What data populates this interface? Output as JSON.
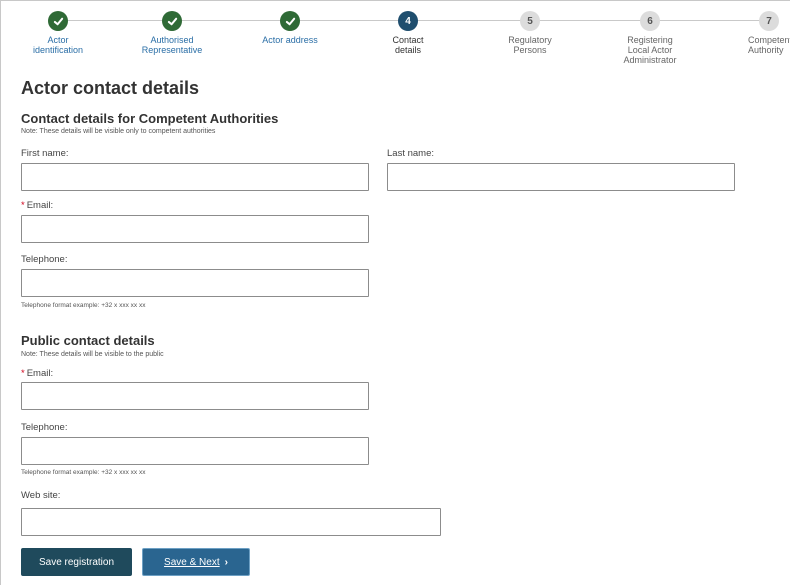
{
  "stepper": {
    "steps": [
      {
        "number": "",
        "label": "Actor\nidentification",
        "state": "done"
      },
      {
        "number": "",
        "label": "Authorised\nRepresentative",
        "state": "done"
      },
      {
        "number": "",
        "label": "Actor address",
        "state": "done"
      },
      {
        "number": "4",
        "label": "Contact\ndetails",
        "state": "current"
      },
      {
        "number": "5",
        "label": "Regulatory\nPersons",
        "state": "todo"
      },
      {
        "number": "6",
        "label": "Registering\nLocal Actor\nAdministrator",
        "state": "todo"
      },
      {
        "number": "7",
        "label": "Competent\nAuthority",
        "state": "todo"
      }
    ],
    "done_icon": "check-icon"
  },
  "page": {
    "title": "Actor contact details"
  },
  "competent": {
    "heading": "Contact details for Competent Authorities",
    "note": "Note: These details will be visible only to competent authorities",
    "first_name_label": "First name:",
    "first_name_value": "",
    "last_name_label": "Last name:",
    "last_name_value": "",
    "email_label": "Email:",
    "email_value": "",
    "telephone_label": "Telephone:",
    "telephone_value": "",
    "telephone_hint": "Telephone format example: +32 x xxx xx xx"
  },
  "public": {
    "heading": "Public contact details",
    "note": "Note: These details will be visible to the public",
    "email_label": "Email:",
    "email_value": "",
    "telephone_label": "Telephone:",
    "telephone_value": "",
    "telephone_hint": "Telephone format example: +32 x xxx xx xx",
    "website_label": "Web site:",
    "website_value": ""
  },
  "required_marker": "*",
  "buttons": {
    "save_label": "Save registration",
    "next_label": "Save & Next",
    "next_chevron": "›"
  },
  "colors": {
    "step_done": "#2f6a36",
    "step_current": "#1f4e6e",
    "link": "#2a6ea6",
    "required": "#d0021b",
    "save_button": "#1f4a5c",
    "next_button": "#2a6590"
  }
}
